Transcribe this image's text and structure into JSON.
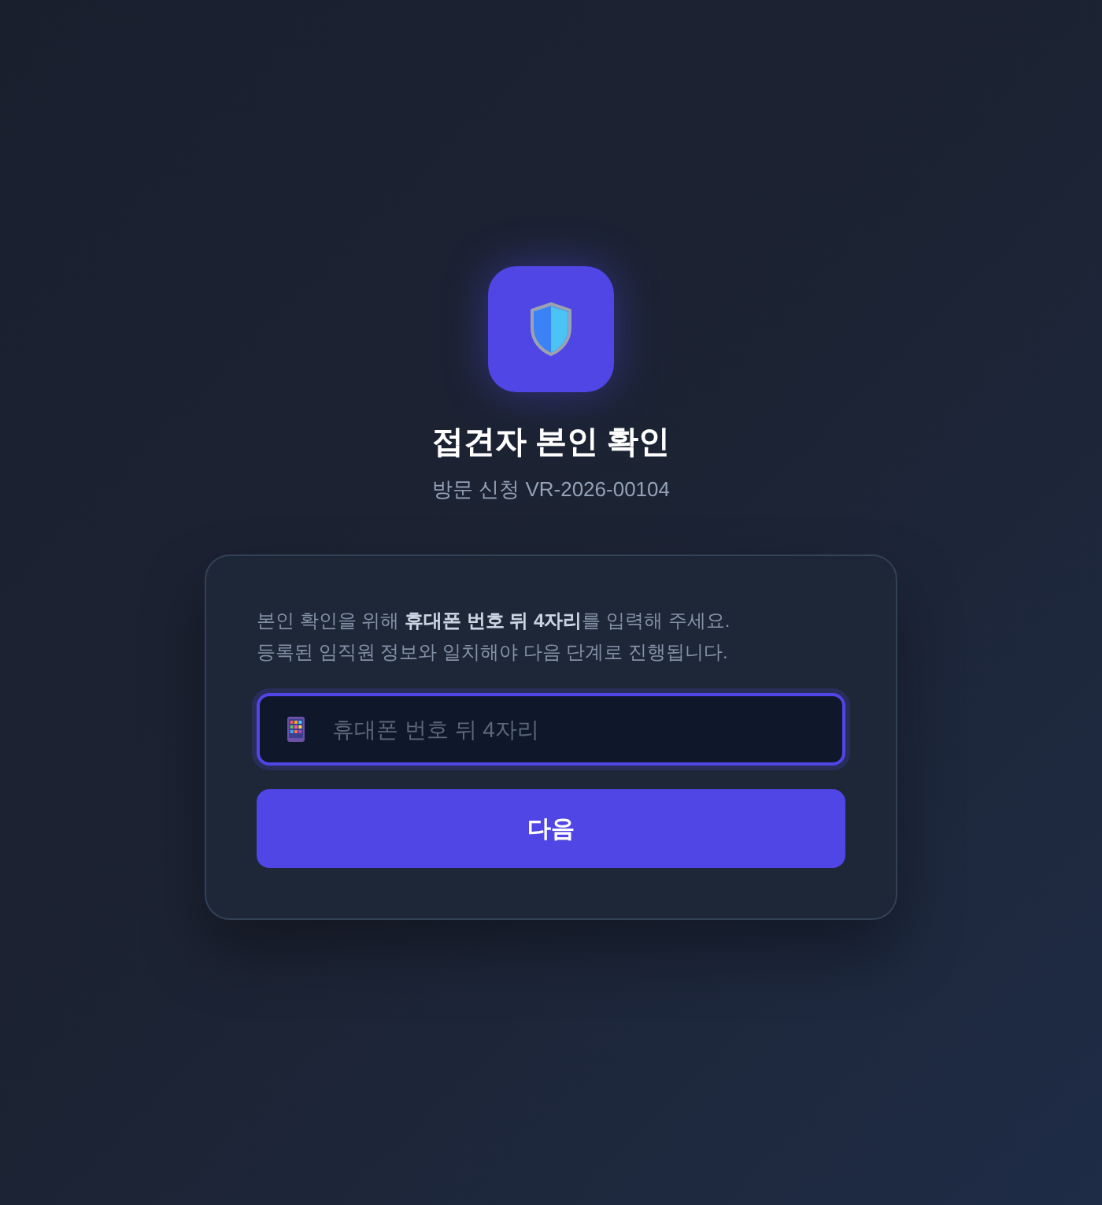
{
  "header": {
    "title": "접견자 본인 확인",
    "subtitle": "방문 신청 VR-2026-00104"
  },
  "card": {
    "instructions": [
      "본인 확인을 위해 **휴대폰 번호 뒤 4자리**를 입력해 주세요.",
      "등록된 임직원 정보와 일치해야 다음 단계로 진행됩니다."
    ],
    "phone_field": {
      "placeholder": "휴대폰 번호 뒤 4자리",
      "focused": true
    },
    "next_button": {
      "label": "다음"
    }
  }
}
